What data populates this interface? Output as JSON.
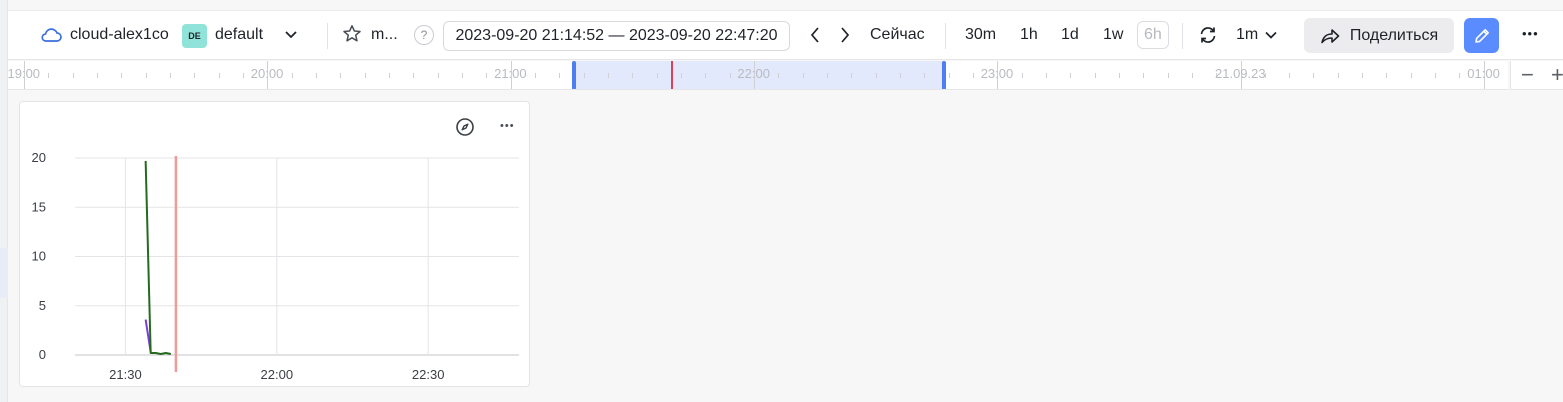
{
  "header": {
    "cloud_name": "cloud-alex1co",
    "folder_badge": "DE",
    "folder_name": "default",
    "dashboard_name": "m...",
    "help_symbol": "?",
    "date_range": "2023-09-20 21:14:52 — 2023-09-20 22:47:20",
    "now_label": "Сейчас",
    "ranges": [
      "30m",
      "1h",
      "1d",
      "1w",
      "6h"
    ],
    "refresh_interval": "1m",
    "share_label": "Поделиться",
    "more_symbol": "•••"
  },
  "timeline": {
    "labels": [
      "19:00",
      "20:00",
      "21:00",
      "22:00",
      "23:00",
      "21.09.23",
      "01:00"
    ],
    "zoom_out": "−",
    "zoom_in": "+"
  },
  "panel": {
    "more_symbol": "•••"
  },
  "colors": {
    "accent": "#5a8cff",
    "series_green": "#256a1f",
    "series_purple": "#7b3fd6",
    "now_marker": "#f29a98"
  },
  "chart_data": {
    "type": "line",
    "ylim": [
      0,
      20
    ],
    "yticks": [
      0,
      5,
      10,
      15,
      20
    ],
    "xticks": [
      "21:30",
      "22:00",
      "22:30"
    ],
    "x_range": [
      "21:20",
      "22:48"
    ],
    "now_marker": "21:40",
    "series": [
      {
        "color": "#256a1f",
        "x": [
          "21:34",
          "21:35",
          "21:36",
          "21:37",
          "21:38",
          "21:39"
        ],
        "values": [
          19.7,
          0.2,
          0.2,
          0.1,
          0.2,
          0.1
        ]
      },
      {
        "color": "#7b3fd6",
        "x": [
          "21:34",
          "21:35"
        ],
        "values": [
          3.6,
          0.3
        ]
      }
    ]
  }
}
